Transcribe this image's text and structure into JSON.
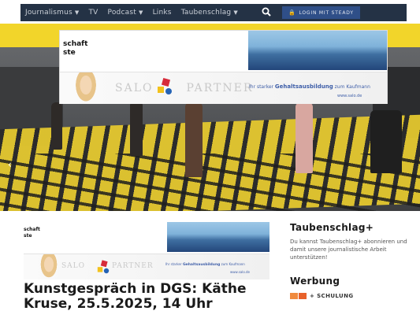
{
  "nav": {
    "items": [
      {
        "label": "Journalismus",
        "has_dropdown": true
      },
      {
        "label": "TV",
        "has_dropdown": false
      },
      {
        "label": "Podcast",
        "has_dropdown": true
      },
      {
        "label": "Links",
        "has_dropdown": false
      },
      {
        "label": "Taubenschlag",
        "has_dropdown": true
      }
    ],
    "search_icon": "search-icon",
    "login_label": "LOGIN MIT STEADY"
  },
  "hero_ad": {
    "text_line1": "schaft",
    "text_line2": "ste",
    "brand_left": "SALO",
    "brand_right": "PARTNER",
    "tagline_pre": "Ihr starker",
    "tagline_bold": "Gehalts­ausbildung",
    "tagline_post": "zum Kaufmann",
    "url": "www.salo.de"
  },
  "small_ad": {
    "text_line1": "schaft",
    "text_line2": "ste",
    "brand_left": "SALO",
    "brand_right": "PARTNER",
    "tagline_pre": "Ihr starker",
    "tagline_bold": "Gehalts­ausbildung",
    "tagline_post": "zum Kaufmann",
    "url": "www.salo.de"
  },
  "article": {
    "title": "Kunstgespräch in DGS: Käthe Kruse, 25.5.2025, 14 Uhr"
  },
  "sidebar": {
    "heading1": "Taubenschlag+",
    "text": "Du kannst Taubenschlag+ abonnieren und damit unsere journalistische Arbeit unterstützen!",
    "heading2": "Werbung",
    "schulung_label": "+ SCHULUNG"
  },
  "colors": {
    "nav_bg": "#243245",
    "login_bg": "#2f4f88",
    "floor_yellow": "#e3c72e",
    "brand_red": "#d72b3a",
    "brand_yellow": "#f3c21c",
    "brand_blue": "#2563b5",
    "schulung_orange": "#e8622b"
  }
}
